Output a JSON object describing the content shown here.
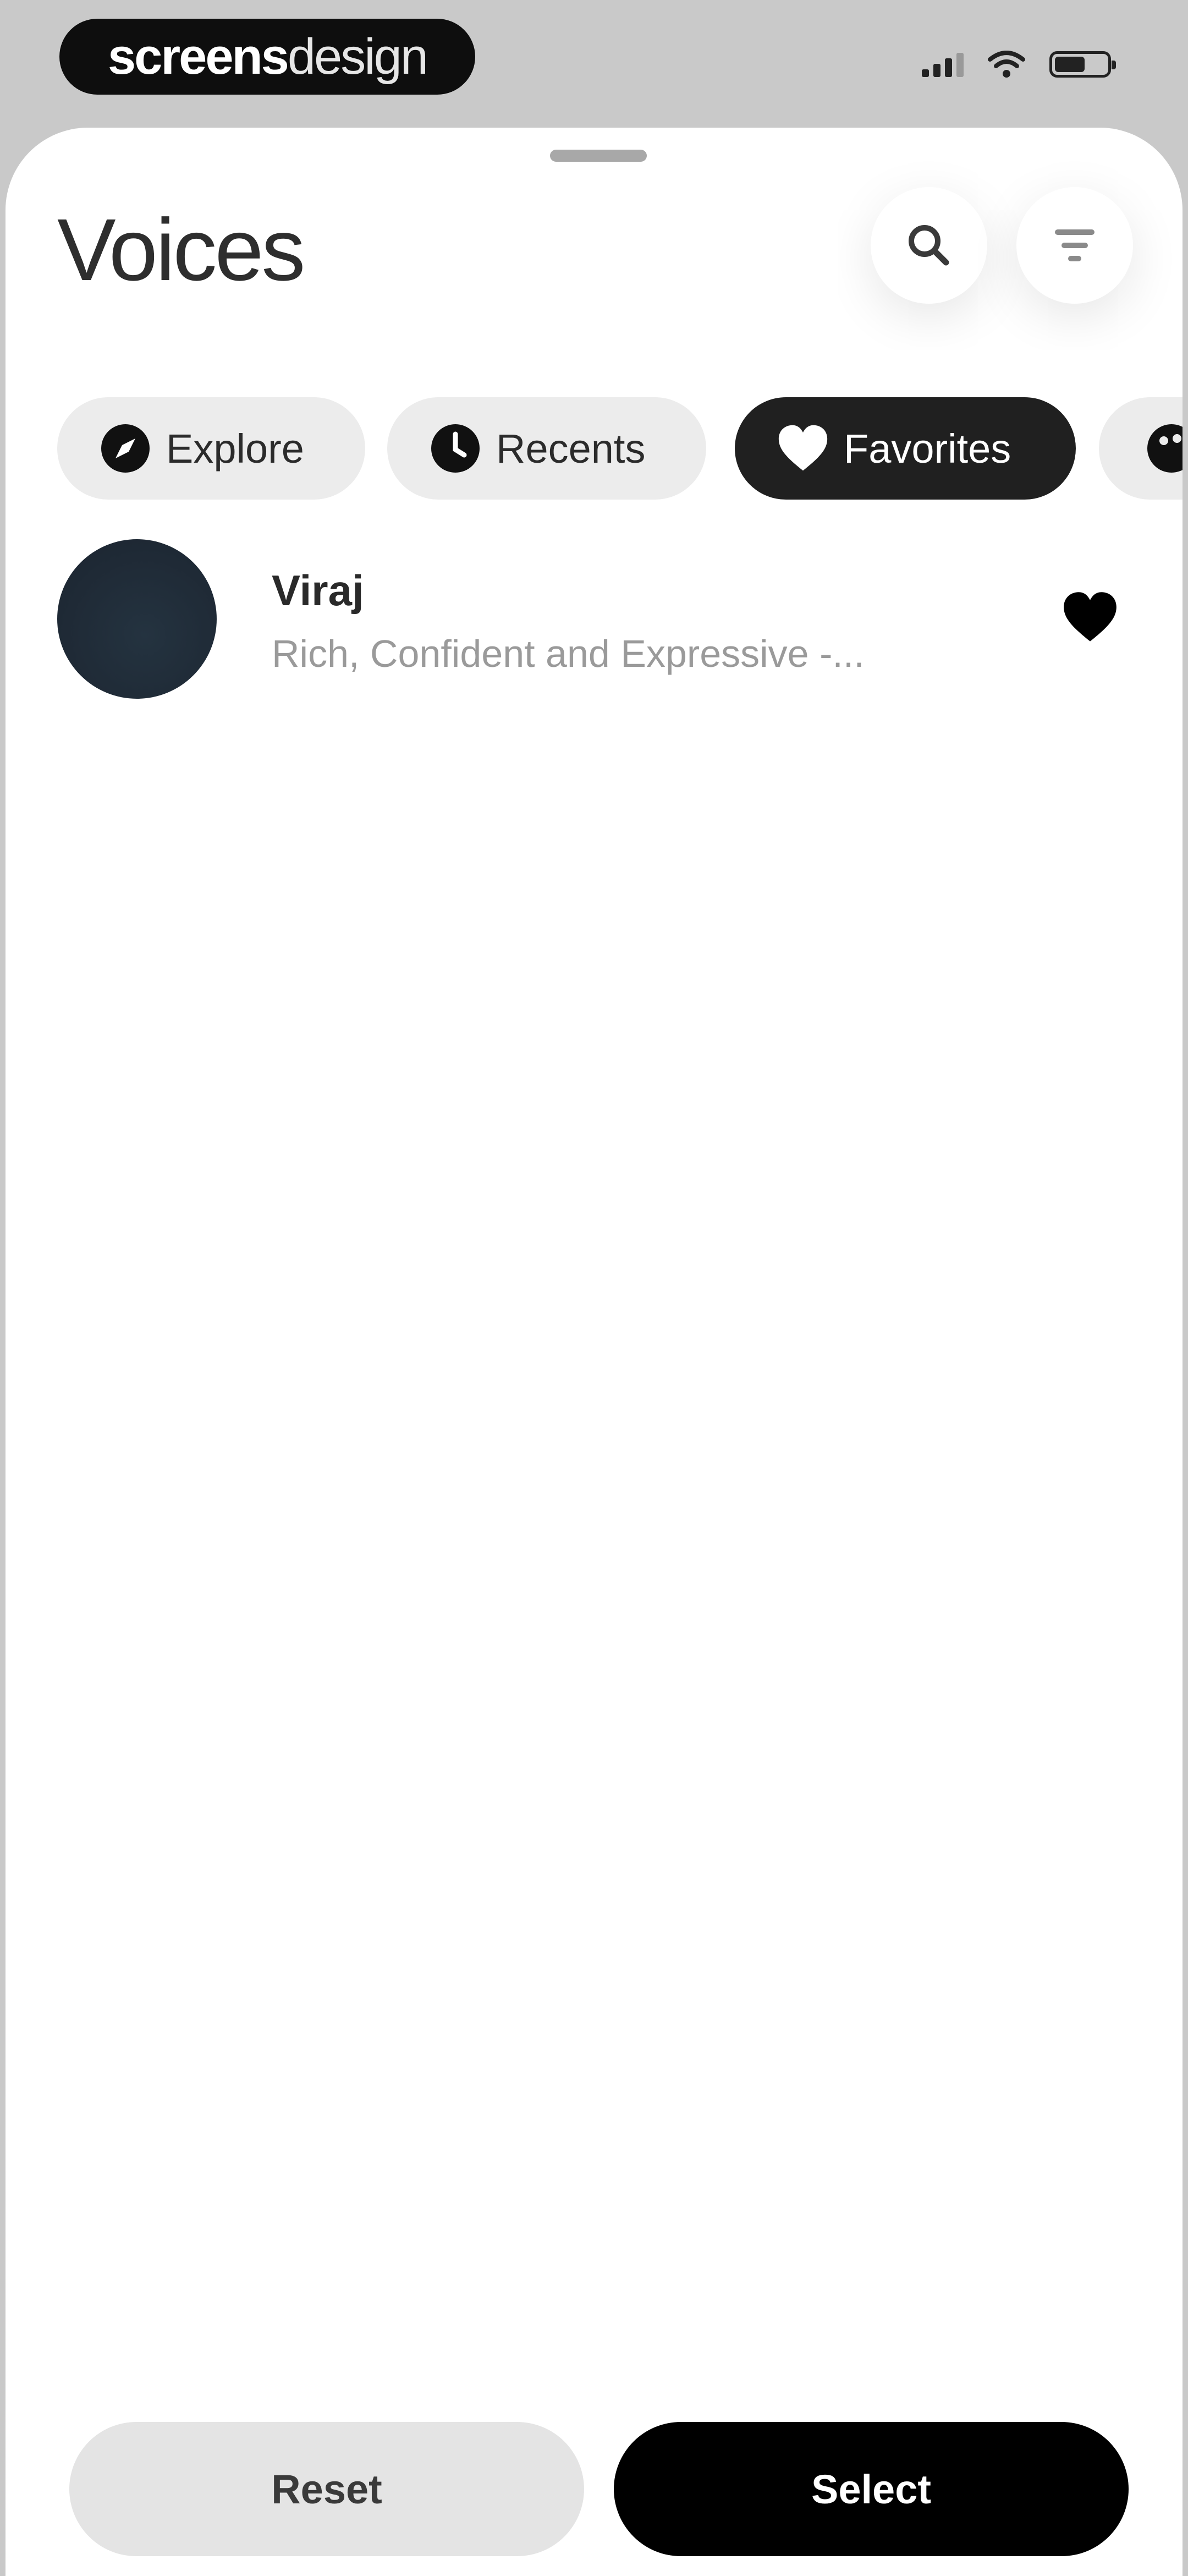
{
  "status_bar": {
    "brand_bold": "screens",
    "brand_light": "design",
    "icons": [
      "cellular-signal-icon",
      "wifi-icon",
      "battery-icon"
    ]
  },
  "sheet": {
    "title": "Voices",
    "actions": [
      "search-icon",
      "filter-icon"
    ]
  },
  "tabs": [
    {
      "label": "Explore",
      "icon": "compass-icon",
      "active": false
    },
    {
      "label": "Recents",
      "icon": "clock-icon",
      "active": false
    },
    {
      "label": "Favorites",
      "icon": "heart-icon",
      "active": true
    },
    {
      "label": "",
      "icon": "palette-icon",
      "active": false
    }
  ],
  "voices": [
    {
      "name": "Viraj",
      "description": "Rich, Confident and Expressive -...",
      "favorited": true
    }
  ],
  "footer": {
    "reset_label": "Reset",
    "select_label": "Select"
  },
  "colors": {
    "accent": "#000000",
    "background": "#ffffff",
    "status_background": "#c9c9c9"
  }
}
